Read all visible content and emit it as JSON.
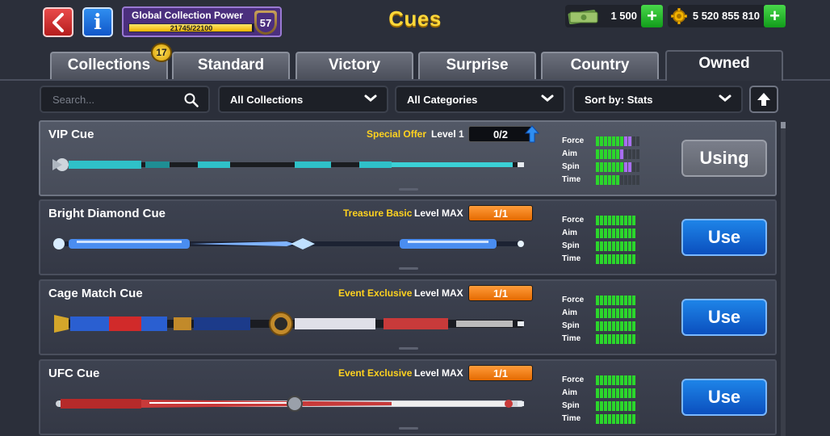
{
  "header": {
    "title": "Cues",
    "collection_power": {
      "label": "Global Collection Power",
      "value_text": "21745/22100",
      "fill_fraction": 0.984,
      "level": "57"
    },
    "cash": "1 500",
    "coins": "5 520 855 810"
  },
  "tabs": [
    {
      "label": "Collections",
      "badge": "17"
    },
    {
      "label": "Standard"
    },
    {
      "label": "Victory"
    },
    {
      "label": "Surprise"
    },
    {
      "label": "Country"
    },
    {
      "label": "Owned",
      "active": true
    }
  ],
  "filters": {
    "search_placeholder": "Search...",
    "collection": "All Collections",
    "category": "All Categories",
    "sort": "Sort by: Stats"
  },
  "cues": [
    {
      "name": "VIP Cue",
      "rarity": "Special Offer",
      "level": "Level 1",
      "progress": "0/2",
      "action": "Using",
      "selected": true,
      "stats": {
        "labels": [
          "Force",
          "Aim",
          "Spin",
          "Time"
        ],
        "values": [
          7,
          6,
          7,
          6
        ],
        "boost": [
          2,
          1,
          2,
          0
        ]
      }
    },
    {
      "name": "Bright Diamond Cue",
      "rarity": "Treasure Basic",
      "level": "Level MAX",
      "progress": "1/1",
      "action": "Use",
      "stats": {
        "labels": [
          "Force",
          "Aim",
          "Spin",
          "Time"
        ],
        "values": [
          10,
          10,
          10,
          10
        ],
        "boost": [
          0,
          0,
          0,
          0
        ]
      }
    },
    {
      "name": "Cage Match Cue",
      "rarity": "Event Exclusive",
      "level": "Level MAX",
      "progress": "1/1",
      "action": "Use",
      "stats": {
        "labels": [
          "Force",
          "Aim",
          "Spin",
          "Time"
        ],
        "values": [
          10,
          10,
          10,
          10
        ],
        "boost": [
          0,
          0,
          0,
          0
        ]
      }
    },
    {
      "name": "UFC Cue",
      "rarity": "Event Exclusive",
      "level": "Level MAX",
      "progress": "1/1",
      "action": "Use",
      "stats": {
        "labels": [
          "Force",
          "Aim",
          "Spin",
          "Time"
        ],
        "values": [
          10,
          10,
          10,
          10
        ],
        "boost": [
          0,
          0,
          0,
          0
        ]
      }
    }
  ],
  "colors": {
    "title": "#ffd83a",
    "rarity": "#ffd21f",
    "stat_on": "#2bd72b",
    "stat_boost": "#a86ef0",
    "use_button": "#1e84e8"
  }
}
